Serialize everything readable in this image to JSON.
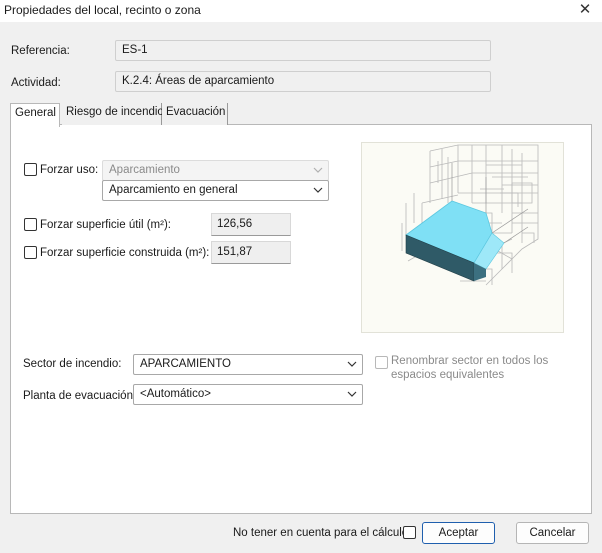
{
  "window": {
    "title": "Propiedades del local, recinto o zona",
    "close_glyph": "✕"
  },
  "header": {
    "referencia_label": "Referencia:",
    "referencia_value": "ES-1",
    "actividad_label": "Actividad:",
    "actividad_value": "K.2.4: Áreas de aparcamiento"
  },
  "tabs": [
    {
      "label": "General",
      "active": true
    },
    {
      "label": "Riesgo de incendio",
      "active": false
    },
    {
      "label": "Evacuación",
      "active": false
    }
  ],
  "general": {
    "forzar_uso_label": "Forzar uso:",
    "uso_select_value": "Aparcamiento",
    "uso_subselect_value": "Aparcamiento en general",
    "forzar_util_label": "Forzar superficie útil (m²):",
    "superficie_util": "126,56",
    "forzar_construida_label": "Forzar superficie construida (m²):",
    "superficie_construida": "151,87",
    "sector_label": "Sector de incendio:",
    "sector_value": "APARCAMIENTO",
    "renombrar_line1": "Renombrar sector en todos los",
    "renombrar_line2": "espacios equivalentes",
    "planta_label": "Planta de evacuación:",
    "planta_value": "<Automático>"
  },
  "footer": {
    "ignore_label": "No tener en cuenta para el cálculo",
    "accept_label": "Aceptar",
    "cancel_label": "Cancelar"
  },
  "colors": {
    "accent": "#1f5fae",
    "model_fill": "#7fe0f5",
    "model_dark": "#2f5a67"
  }
}
